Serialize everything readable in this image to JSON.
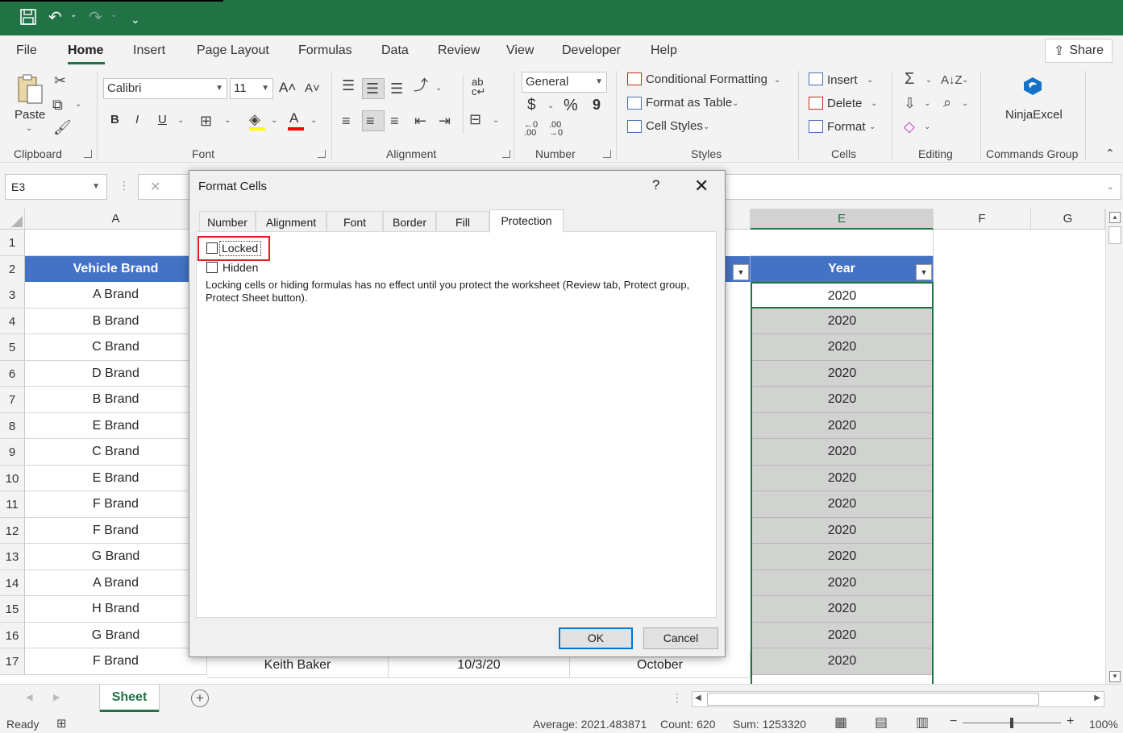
{
  "menu": {
    "tabs": [
      "File",
      "Home",
      "Insert",
      "Page Layout",
      "Formulas",
      "Data",
      "Review",
      "View",
      "Developer",
      "Help"
    ],
    "active": "Home",
    "share_label": "Share"
  },
  "ribbon": {
    "clipboard": {
      "paste_label": "Paste",
      "group_label": "Clipboard"
    },
    "font": {
      "family": "Calibri",
      "size": "11",
      "bold": "B",
      "italic": "I",
      "underline": "U",
      "group_label": "Font"
    },
    "alignment": {
      "group_label": "Alignment"
    },
    "number": {
      "format": "General",
      "group_label": "Number",
      "dollar": "$",
      "percent": "%",
      "comma": "9"
    },
    "styles": {
      "conditional_formatting": "Conditional Formatting",
      "format_as_table": "Format as Table",
      "cell_styles": "Cell Styles",
      "group_label": "Styles"
    },
    "cells": {
      "insert": "Insert",
      "delete": "Delete",
      "format": "Format",
      "group_label": "Cells"
    },
    "editing": {
      "group_label": "Editing"
    },
    "commands": {
      "ninja_label": "NinjaExcel",
      "group_label": "Commands Group"
    }
  },
  "formula_bar": {
    "name_box": "E3",
    "cancel": "✕"
  },
  "grid": {
    "columns": [
      "A",
      "E",
      "F",
      "G"
    ],
    "row_numbers": [
      "1",
      "2",
      "3",
      "4",
      "5",
      "6",
      "7",
      "8",
      "9",
      "10",
      "11",
      "12",
      "13",
      "14",
      "15",
      "16",
      "17"
    ],
    "header_a": "Vehicle Brand",
    "header_e": "Year",
    "brands": [
      "A Brand",
      "B Brand",
      "C Brand",
      "D Brand",
      "B Brand",
      "E Brand",
      "C Brand",
      "E Brand",
      "F Brand",
      "F Brand",
      "G Brand",
      "A Brand",
      "H Brand",
      "G Brand",
      "F Brand"
    ],
    "years": [
      "2020",
      "2020",
      "2020",
      "2020",
      "2020",
      "2020",
      "2020",
      "2020",
      "2020",
      "2020",
      "2020",
      "2020",
      "2020",
      "2020",
      "2020"
    ],
    "row17": {
      "b": "Keith Baker",
      "c": "10/3/20",
      "d": "October"
    }
  },
  "sheet_tab": "Sheet",
  "status": {
    "ready": "Ready",
    "average": "Average: 2021.483871",
    "count": "Count: 620",
    "sum": "Sum: 1253320",
    "zoom": "100%"
  },
  "dialog": {
    "title": "Format Cells",
    "help": "?",
    "close": "✕",
    "tabs": [
      "Number",
      "Alignment",
      "Font",
      "Border",
      "Fill",
      "Protection"
    ],
    "active_tab": "Protection",
    "locked_label": "Locked",
    "hidden_label": "Hidden",
    "locked_checked": false,
    "hidden_checked": false,
    "note": "Locking cells or hiding formulas has no effect until you protect the worksheet (Review tab, Protect group, Protect Sheet button).",
    "ok_label": "OK",
    "cancel_label": "Cancel"
  }
}
